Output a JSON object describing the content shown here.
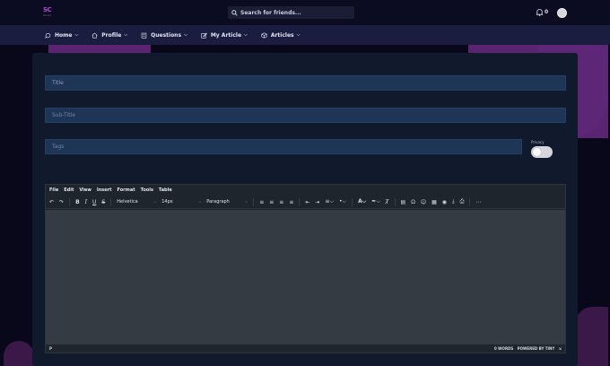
{
  "brand": {
    "logo_text": "SC",
    "logo_sub": "Scrivn"
  },
  "search": {
    "placeholder": "Search for friends..."
  },
  "notifications": {
    "count": "0"
  },
  "nav": {
    "items": [
      {
        "label": "Home",
        "icon": "chat-icon"
      },
      {
        "label": "Profile",
        "icon": "home-icon"
      },
      {
        "label": "Questions",
        "icon": "clipboard-icon"
      },
      {
        "label": "My Article",
        "icon": "edit-icon"
      },
      {
        "label": "Articles",
        "icon": "cube-icon"
      }
    ]
  },
  "form": {
    "title_placeholder": "Title",
    "subtitle_placeholder": "Sub-Title",
    "tags_placeholder": "Tags",
    "privacy_label": "Privacy"
  },
  "editor": {
    "menu": [
      "File",
      "Edit",
      "View",
      "Insert",
      "Format",
      "Tools",
      "Table"
    ],
    "font_family": "Helvetica",
    "font_size": "14px",
    "block_format": "Paragraph",
    "path": "P",
    "word_count": "0 WORDS",
    "powered_by": "POWERED BY TINY"
  },
  "colors": {
    "background": "#08081a",
    "accent": "#5a2470",
    "nav": "#1b1d40",
    "card": "#101a2c",
    "field": "#1e3556",
    "editor": "#353b43"
  }
}
